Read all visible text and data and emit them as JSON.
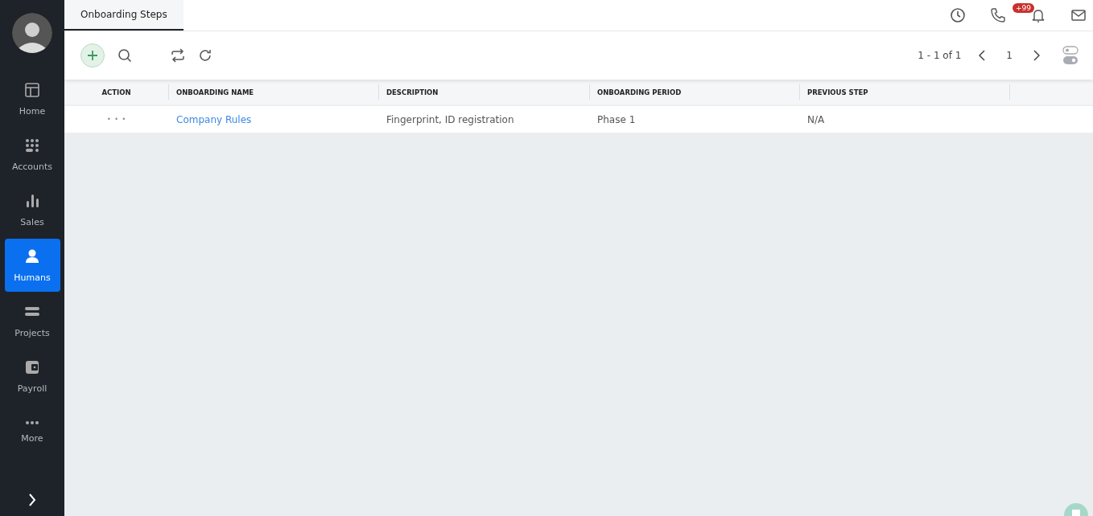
{
  "sidebar": {
    "items": [
      {
        "kind": "home",
        "label": "Home",
        "selected": false
      },
      {
        "kind": "grid",
        "label": "Accounts",
        "selected": false
      },
      {
        "kind": "bars",
        "label": "Sales",
        "selected": false
      },
      {
        "kind": "person",
        "label": "Humans",
        "selected": true
      },
      {
        "kind": "lines",
        "label": "Projects",
        "selected": false
      },
      {
        "kind": "wallet",
        "label": "Payroll",
        "selected": false
      },
      {
        "kind": "dots",
        "label": "More",
        "selected": false
      }
    ]
  },
  "tabs": [
    {
      "label": "Onboarding Steps",
      "selected": true
    }
  ],
  "header": {
    "notification_badge": "+99"
  },
  "pagination": {
    "range": "1 - 1 of 1",
    "page": "1"
  },
  "table": {
    "columns": [
      "ACTION",
      "ONBOARDING NAME",
      "DESCRIPTION",
      "ONBOARDING PERIOD",
      "PREVIOUS STEP"
    ],
    "rows": [
      {
        "action": "• • •",
        "name": "Company Rules",
        "description": "Fingerprint, ID registration",
        "period": "Phase 1",
        "previous": "N/A"
      }
    ]
  }
}
